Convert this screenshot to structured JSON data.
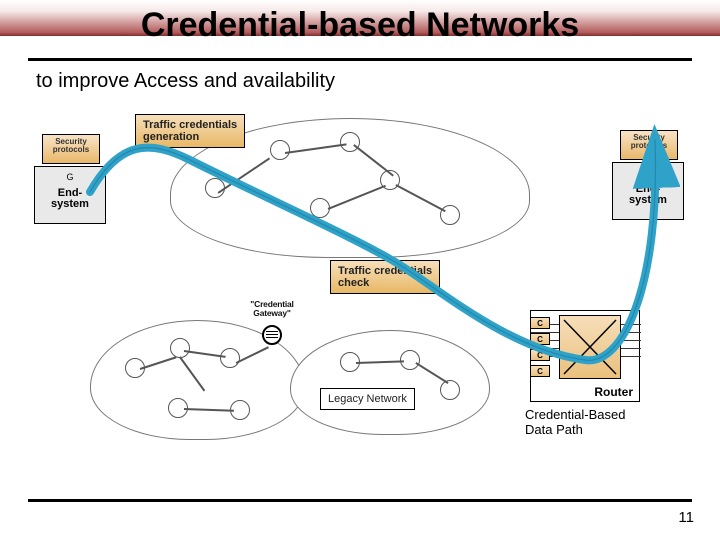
{
  "slide": {
    "title": "Credential-based Networks",
    "subtitle": "to improve Access and availability",
    "page_number": "11"
  },
  "labels": {
    "traffic_gen": "Traffic credentials\ngeneration",
    "traffic_check": "Traffic credentials\ncheck",
    "legacy": "Legacy Network",
    "credential_gateway": "\"Credential\nGateway\"",
    "router": "Router",
    "cbdp_line1": "Credential-Based",
    "cbdp_line2": "Data Path"
  },
  "endsystem": {
    "label": "End-\nsystem",
    "g": "G"
  },
  "security": {
    "label": "Security\nprotocols"
  },
  "router": {
    "badge": "C"
  },
  "colors": {
    "flow": "#2ea2c8",
    "flow_dark": "#1b6e8e"
  }
}
